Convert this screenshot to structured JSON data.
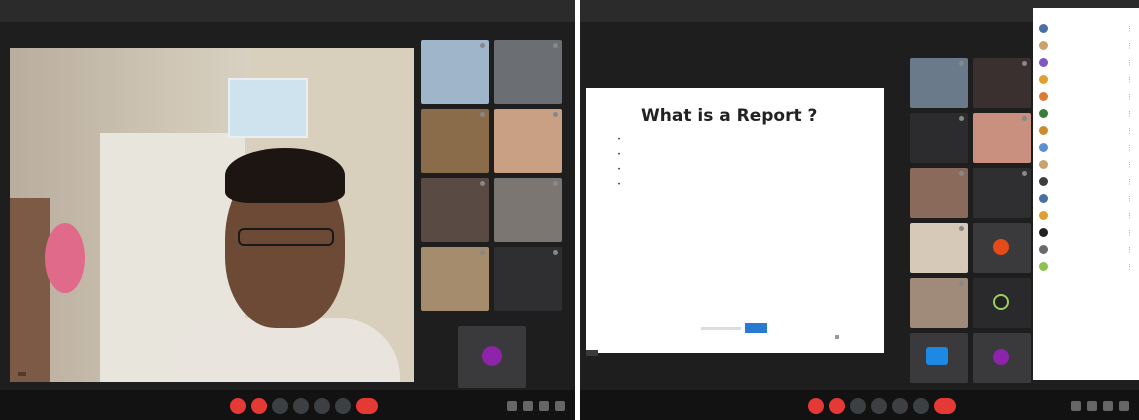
{
  "left_window": {
    "title": "",
    "meta": "",
    "speaker_tag": "",
    "time": "",
    "tiles": [
      {
        "label": ""
      },
      {
        "label": ""
      },
      {
        "label": ""
      },
      {
        "label": ""
      },
      {
        "label": ""
      },
      {
        "label": ""
      },
      {
        "label": ""
      },
      {
        "label": ""
      },
      {
        "label": ""
      },
      {
        "label": ""
      }
    ]
  },
  "right_window": {
    "title": "",
    "presenting_label": "",
    "present_chip": "",
    "time": "",
    "slide": {
      "title": "What is a Report ?",
      "bullets": [
        "",
        "",
        "",
        ""
      ]
    },
    "tiles": [
      {
        "label": ""
      },
      {
        "label": ""
      },
      {
        "label": ""
      },
      {
        "label": ""
      },
      {
        "label": ""
      },
      {
        "label": ""
      },
      {
        "label": ""
      },
      {
        "label": ""
      },
      {
        "label": ""
      },
      {
        "label": ""
      },
      {
        "label": ""
      },
      {
        "label": ""
      }
    ],
    "people_panel": {
      "header": "",
      "rows": [
        {
          "name": "",
          "color": "#4a6fa5"
        },
        {
          "name": "",
          "color": "#c9a36b"
        },
        {
          "name": "",
          "color": "#7e57c2"
        },
        {
          "name": "",
          "color": "#e0a030"
        },
        {
          "name": "",
          "color": "#e07a30"
        },
        {
          "name": "",
          "color": "#3a7e3a"
        },
        {
          "name": "",
          "color": "#d08a2e"
        },
        {
          "name": "",
          "color": "#5b8fd0"
        },
        {
          "name": "",
          "color": "#c9a36b"
        },
        {
          "name": "",
          "color": "#3e3e3e"
        },
        {
          "name": "",
          "color": "#4a6fa5"
        },
        {
          "name": "",
          "color": "#e0a030"
        },
        {
          "name": "",
          "color": "#222222"
        },
        {
          "name": "",
          "color": "#6a6a6a"
        },
        {
          "name": "",
          "color": "#8bc34a"
        }
      ]
    }
  },
  "colors": {
    "accent_red": "#e53935",
    "slide_highlight": "#c0392b",
    "tile_bg": "#3a3a3c",
    "bar_bg": "#121213",
    "frame_bg": "#1e1e1f"
  }
}
